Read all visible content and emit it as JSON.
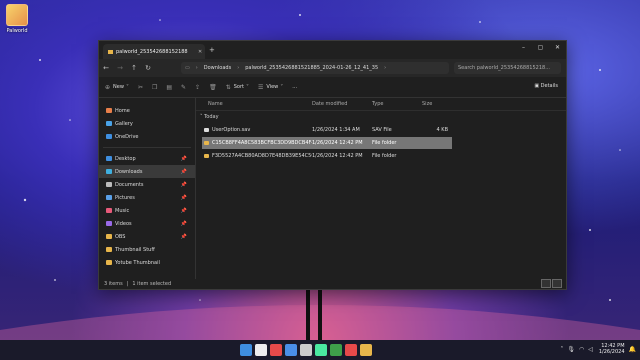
{
  "desktop": {
    "icon_label": "Palworld"
  },
  "window": {
    "tab_title": "palworld_253542688152188",
    "new_tab": "+",
    "controls": [
      "–",
      "▢",
      "✕"
    ]
  },
  "address": {
    "crumbs": [
      "Downloads",
      "palworld_2535426881521885_2024-01-26_12_41_35"
    ],
    "search_placeholder": "Search palworld_25354268815218..."
  },
  "toolbar": {
    "new_label": "New",
    "sort_label": "Sort",
    "view_label": "View",
    "more_label": "...",
    "details_label": "Details"
  },
  "sidebar": {
    "top": [
      {
        "label": "Home",
        "color": "#e87f4a"
      },
      {
        "label": "Gallery",
        "color": "#4aa3e8"
      },
      {
        "label": "OneDrive",
        "color": "#3f8fe0"
      }
    ],
    "quick": [
      {
        "label": "Desktop",
        "color": "#3f8fe0",
        "pinned": true
      },
      {
        "label": "Downloads",
        "color": "#3fb0e0",
        "pinned": true,
        "selected": true
      },
      {
        "label": "Documents",
        "color": "#bbbbbb",
        "pinned": true
      },
      {
        "label": "Pictures",
        "color": "#5aa0e8",
        "pinned": true
      },
      {
        "label": "Music",
        "color": "#e85a7a",
        "pinned": true
      },
      {
        "label": "Videos",
        "color": "#9a6ae8",
        "pinned": true
      },
      {
        "label": "OBS",
        "color": "#e8b64b",
        "pinned": true
      },
      {
        "label": "Thumbnail Stuff",
        "color": "#e8b64b",
        "pinned": false
      },
      {
        "label": "Yotube Thumbnail",
        "color": "#e8b64b",
        "pinned": false
      }
    ]
  },
  "columns": [
    "Name",
    "Date modified",
    "Type",
    "Size"
  ],
  "group_label": "Today",
  "files": [
    {
      "name": "UserOption.sav",
      "date": "1/26/2024 1:34 AM",
      "type": "SAV File",
      "size": "4 KB",
      "selected": false,
      "folder": false
    },
    {
      "name": "C15CB8FF4A8C583BCFBC3DD9BDCB4F485",
      "date": "1/26/2024 12:42 PM",
      "type": "File folder",
      "size": "",
      "selected": true,
      "folder": true
    },
    {
      "name": "F3D5527A4CB80AD8D7E48DB39E54C503",
      "date": "1/26/2024 12:42 PM",
      "type": "File folder",
      "size": "",
      "selected": false,
      "folder": true
    }
  ],
  "status": {
    "items": "3 items",
    "selected": "1 item selected"
  },
  "taskbar": {
    "time": "12:42 PM",
    "date": "1/26/2024",
    "app_colors": [
      "#3f8fe0",
      "#eeeeee",
      "#e84a4a",
      "#4a8fe8",
      "#cccccc",
      "#4ae8a0",
      "#3fa04a",
      "#e84a4a",
      "#e8b64b"
    ]
  }
}
